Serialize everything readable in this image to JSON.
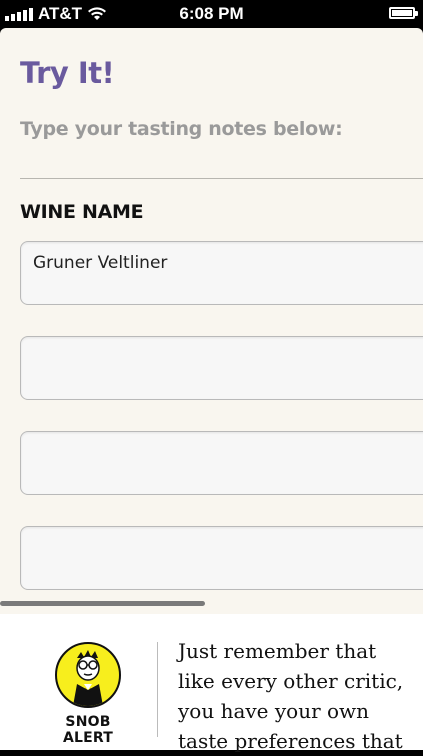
{
  "status_bar": {
    "carrier": "AT&T",
    "time": "6:08 PM",
    "signal_icon": "signal-bars-icon",
    "wifi_icon": "wifi-icon",
    "battery_icon": "battery-icon",
    "battery_level": 0.9
  },
  "main": {
    "title": "Try It!",
    "subtitle": "Type your tasting notes below:",
    "field_label": "WINE NAME",
    "fields": [
      {
        "value": "Gruner Veltliner"
      },
      {
        "value": ""
      },
      {
        "value": ""
      },
      {
        "value": ""
      }
    ]
  },
  "footer": {
    "icon": "snob-alert-icon",
    "icon_label": "SNOB ALERT",
    "quote": "Just remember that like every other critic, you have your own taste preferences that"
  },
  "colors": {
    "accent": "#6a5a9e",
    "sheet_background": "#f9f6ef",
    "icon_yellow": "#f7ee1d"
  }
}
